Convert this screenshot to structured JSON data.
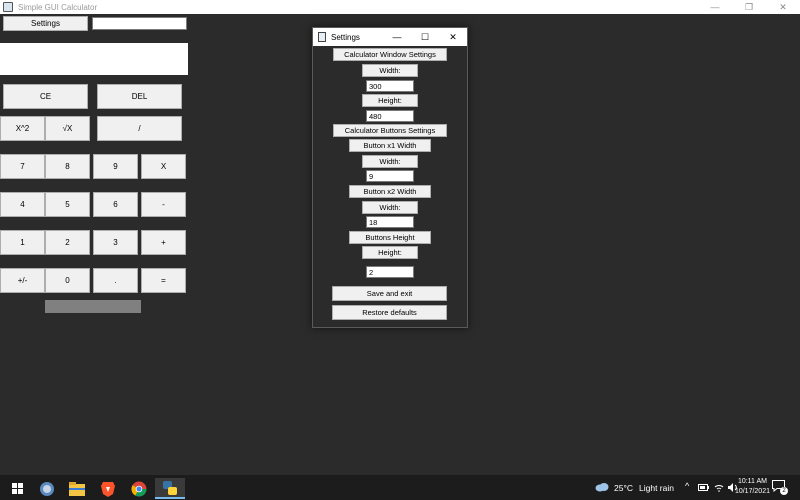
{
  "window": {
    "title": "Simple GUI Calculator",
    "minimize": "—",
    "maximize": "❐",
    "close": "✕"
  },
  "calculator": {
    "settings_label": "Settings",
    "top_entry_value": "",
    "display_value": "",
    "buttons": {
      "ce": "CE",
      "del": "DEL",
      "pow2": "X^2",
      "sqrt": "√X",
      "divide": "/",
      "seven": "7",
      "eight": "8",
      "nine": "9",
      "multiply": "X",
      "four": "4",
      "five": "5",
      "six": "6",
      "minus": "-",
      "one": "1",
      "two": "2",
      "three": "3",
      "plus": "+",
      "negate": "+/-",
      "zero": "0",
      "dot": ".",
      "equals": "="
    }
  },
  "settings_dialog": {
    "title": "Settings",
    "minimize": "—",
    "maximize": "☐",
    "close": "✕",
    "window_settings_label": "Calculator Window Settings",
    "width_label": "Width:",
    "width_value": "300",
    "height_label": "Height:",
    "height_value": "480",
    "buttons_settings_label": "Calculator Buttons Settings",
    "x1_width_label": "Button x1 Width",
    "x1_width_sub_label": "Width:",
    "x1_width_value": "9",
    "x2_width_label": "Button x2 Width",
    "x2_width_sub_label": "Width:",
    "x2_width_value": "18",
    "buttons_height_label": "Buttons Height",
    "buttons_height_sub_label": "Height:",
    "buttons_height_value": "2",
    "save_label": "Save and exit",
    "restore_label": "Restore defaults"
  },
  "taskbar": {
    "weather_temp": "25°C",
    "weather_desc": "Light rain",
    "time": "10:11 AM",
    "date": "10/17/2021",
    "notification_count": "2",
    "icons": [
      "windows-start-icon",
      "browser-icon",
      "file-explorer-icon",
      "brave-icon",
      "chrome-icon",
      "python-icon"
    ]
  },
  "colors": {
    "background": "#2b2b2b",
    "button": "#f0f0f0",
    "taskbar": "#1c1c1c",
    "accent": "#76b9ed"
  }
}
